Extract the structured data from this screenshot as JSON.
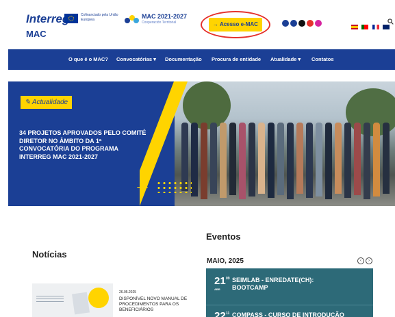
{
  "header": {
    "logo_interreg": "Interreg",
    "logo_mac": "MAC",
    "eu_text": "Cofinanciado pela União Europeia",
    "mac_logo_title": "MAC 2021-2027",
    "mac_logo_subtitle": "Cooperación Territorial",
    "access_button": "→ Acesso e-MAC"
  },
  "nav": {
    "items": [
      "O que é o MAC?",
      "Convocatórias ▾",
      "Documentação",
      "Procura de entidade",
      "Atualidade ▾",
      "Contatos"
    ]
  },
  "hero": {
    "badge": "Actualidade",
    "title": "34 PROJETOS APROVADOS PELO COMITÉ DIRETOR NO ÂMBITO DA 1ª CONVOCATÓRIA DO PROGRAMA INTERREG MAC 2021-2027"
  },
  "news": {
    "heading": "Notícias",
    "item_date": "26.05.2025",
    "item_title": "DISPONÍVEL NOVO MANUAL DE PROCEDIMENTOS PARA OS BENEFICIÁRIOS"
  },
  "events": {
    "heading": "Eventos",
    "month": "MAIO, 2025",
    "items": [
      {
        "day": "21",
        "time": "09",
        "month_abbr": "ABR",
        "title": "SEIMLAB - ENREDATE(CH): BOOTCAMP"
      },
      {
        "day": "22",
        "time": "11",
        "month_abbr": "",
        "title": "COMPASS - CURSO DE INTRODUÇÃO"
      }
    ]
  },
  "colors": {
    "primary": "#1b3f95",
    "accent": "#ffd400",
    "event_bg": "#2d6a78",
    "highlight_ring": "#e5322d"
  },
  "icons": [
    "linkedin-icon",
    "facebook-icon",
    "x-icon",
    "youtube-icon",
    "instagram-icon",
    "search-icon"
  ]
}
